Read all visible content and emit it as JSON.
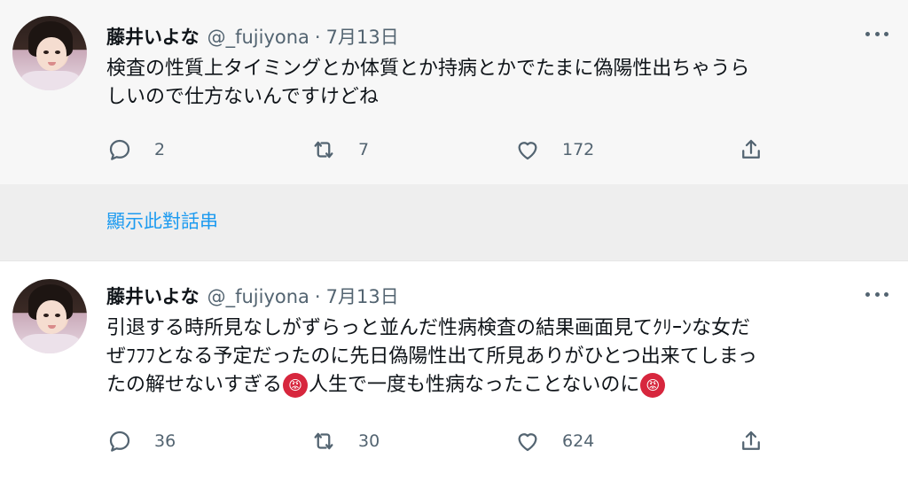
{
  "tweets": [
    {
      "name": "藤井いよな",
      "handle": "@_fujiyona",
      "dot": "·",
      "date": "7月13日",
      "text": "検査の性質上タイミングとか体質とか持病とかでたまに偽陽性出ちゃうら\nしいので仕方ないんですけどね",
      "replies": "2",
      "retweets": "7",
      "likes": "172"
    },
    {
      "name": "藤井いよな",
      "handle": "@_fujiyona",
      "dot": "·",
      "date": "7月13日",
      "text_part1": "引退する時所見なしがずらっと並んだ性病検査の結果画面見てｸﾘｰﾝな女だ\nぜﾌﾌﾌとなる予定だったのに先日偽陽性出て所見ありがひとつ出来てしまっ\nたの解せないすぎる",
      "text_part2": "人生で一度も性病なったことないのに",
      "emoji": "😡",
      "replies": "36",
      "retweets": "30",
      "likes": "624"
    }
  ],
  "thread_link": "顯示此對話串",
  "icons": {
    "reply": "reply-icon",
    "retweet": "retweet-icon",
    "like": "like-icon",
    "share": "share-icon",
    "more": "more-icon"
  },
  "colors": {
    "link": "#1d9bf0",
    "secondary_text": "#536471",
    "primary_text": "#0f1419",
    "angry_emoji": "#d7263d"
  }
}
